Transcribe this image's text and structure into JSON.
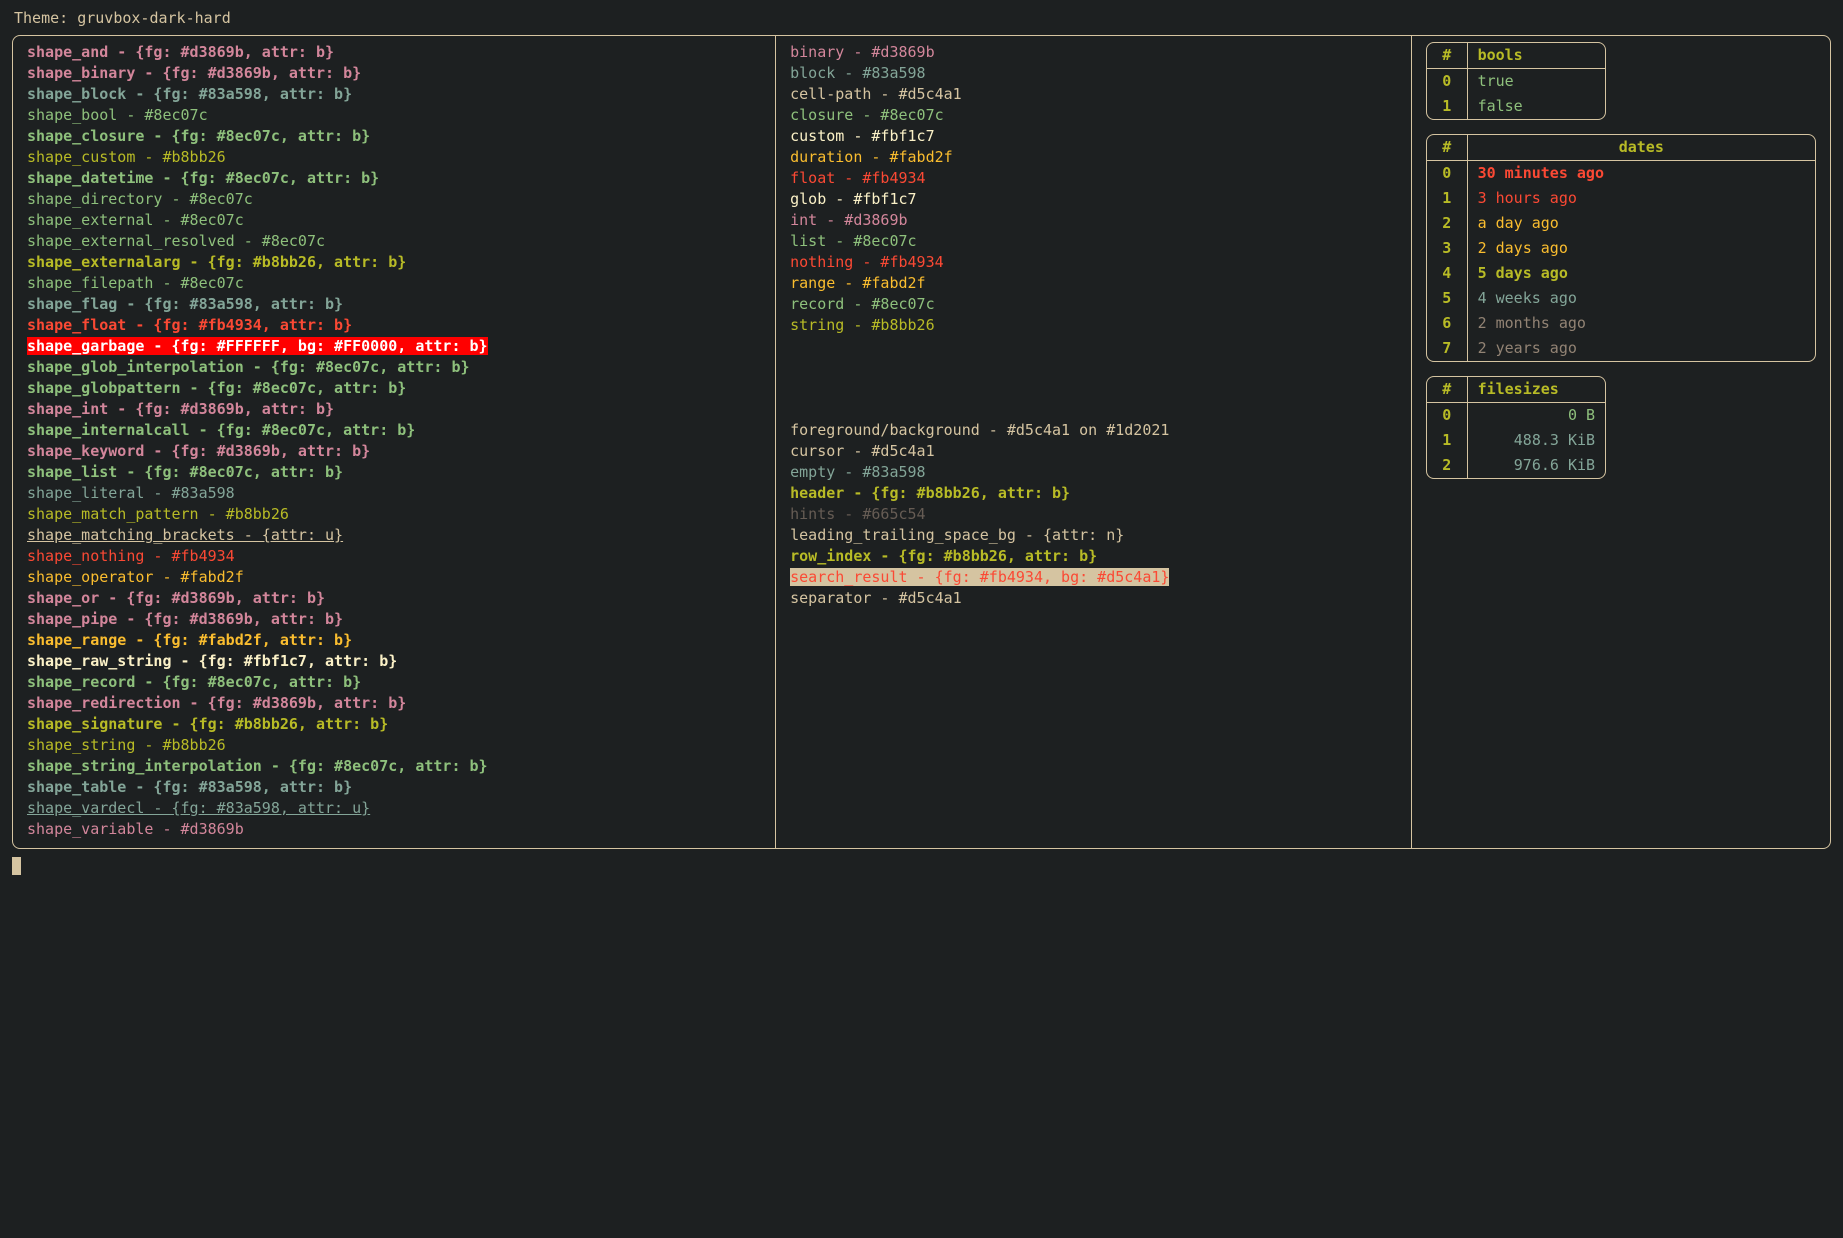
{
  "title": "Theme: gruvbox-dark-hard",
  "palette": {
    "fg": "#d5c4a1",
    "bg": "#1d2021",
    "yellowB": "#fabd2f",
    "yellow": "#b8bb26",
    "aqua": "#8ec07c",
    "blue": "#83a598",
    "purple": "#d3869b",
    "red": "#fb4934",
    "white": "#fbf1c7",
    "dim": "#665c54"
  },
  "shapes": [
    {
      "name": "shape_and",
      "def": "{fg: #d3869b, attr: b}",
      "fg": "#d3869b",
      "bold": true
    },
    {
      "name": "shape_binary",
      "def": "{fg: #d3869b, attr: b}",
      "fg": "#d3869b",
      "bold": true
    },
    {
      "name": "shape_block",
      "def": "{fg: #83a598, attr: b}",
      "fg": "#83a598",
      "bold": true
    },
    {
      "name": "shape_bool",
      "def": "#8ec07c",
      "fg": "#8ec07c"
    },
    {
      "name": "shape_closure",
      "def": "{fg: #8ec07c, attr: b}",
      "fg": "#8ec07c",
      "bold": true
    },
    {
      "name": "shape_custom",
      "def": "#b8bb26",
      "fg": "#b8bb26"
    },
    {
      "name": "shape_datetime",
      "def": "{fg: #8ec07c, attr: b}",
      "fg": "#8ec07c",
      "bold": true
    },
    {
      "name": "shape_directory",
      "def": "#8ec07c",
      "fg": "#8ec07c"
    },
    {
      "name": "shape_external",
      "def": "#8ec07c",
      "fg": "#8ec07c"
    },
    {
      "name": "shape_external_resolved",
      "def": "#8ec07c",
      "fg": "#8ec07c"
    },
    {
      "name": "shape_externalarg",
      "def": "{fg: #b8bb26, attr: b}",
      "fg": "#b8bb26",
      "bold": true
    },
    {
      "name": "shape_filepath",
      "def": "#8ec07c",
      "fg": "#8ec07c"
    },
    {
      "name": "shape_flag",
      "def": "{fg: #83a598, attr: b}",
      "fg": "#83a598",
      "bold": true
    },
    {
      "name": "shape_float",
      "def": "{fg: #fb4934, attr: b}",
      "fg": "#fb4934",
      "bold": true
    },
    {
      "name": "shape_garbage",
      "def": "{fg: #FFFFFF, bg: #FF0000, attr: b}",
      "fg": "#FFFFFF",
      "bg": "#FF0000",
      "bold": true
    },
    {
      "name": "shape_glob_interpolation",
      "def": "{fg: #8ec07c, attr: b}",
      "fg": "#8ec07c",
      "bold": true
    },
    {
      "name": "shape_globpattern",
      "def": "{fg: #8ec07c, attr: b}",
      "fg": "#8ec07c",
      "bold": true
    },
    {
      "name": "shape_int",
      "def": "{fg: #d3869b, attr: b}",
      "fg": "#d3869b",
      "bold": true
    },
    {
      "name": "shape_internalcall",
      "def": "{fg: #8ec07c, attr: b}",
      "fg": "#8ec07c",
      "bold": true
    },
    {
      "name": "shape_keyword",
      "def": "{fg: #d3869b, attr: b}",
      "fg": "#d3869b",
      "bold": true
    },
    {
      "name": "shape_list",
      "def": "{fg: #8ec07c, attr: b}",
      "fg": "#8ec07c",
      "bold": true
    },
    {
      "name": "shape_literal",
      "def": "#83a598",
      "fg": "#83a598"
    },
    {
      "name": "shape_match_pattern",
      "def": "#b8bb26",
      "fg": "#b8bb26"
    },
    {
      "name": "shape_matching_brackets",
      "def": "{attr: u}",
      "fg": "#d5c4a1",
      "under": true
    },
    {
      "name": "shape_nothing",
      "def": "#fb4934",
      "fg": "#fb4934"
    },
    {
      "name": "shape_operator",
      "def": "#fabd2f",
      "fg": "#fabd2f"
    },
    {
      "name": "shape_or",
      "def": "{fg: #d3869b, attr: b}",
      "fg": "#d3869b",
      "bold": true
    },
    {
      "name": "shape_pipe",
      "def": "{fg: #d3869b, attr: b}",
      "fg": "#d3869b",
      "bold": true
    },
    {
      "name": "shape_range",
      "def": "{fg: #fabd2f, attr: b}",
      "fg": "#fabd2f",
      "bold": true
    },
    {
      "name": "shape_raw_string",
      "def": "{fg: #fbf1c7, attr: b}",
      "fg": "#fbf1c7",
      "bold": true
    },
    {
      "name": "shape_record",
      "def": "{fg: #8ec07c, attr: b}",
      "fg": "#8ec07c",
      "bold": true
    },
    {
      "name": "shape_redirection",
      "def": "{fg: #d3869b, attr: b}",
      "fg": "#d3869b",
      "bold": true
    },
    {
      "name": "shape_signature",
      "def": "{fg: #b8bb26, attr: b}",
      "fg": "#b8bb26",
      "bold": true
    },
    {
      "name": "shape_string",
      "def": "#b8bb26",
      "fg": "#b8bb26"
    },
    {
      "name": "shape_string_interpolation",
      "def": "{fg: #8ec07c, attr: b}",
      "fg": "#8ec07c",
      "bold": true
    },
    {
      "name": "shape_table",
      "def": "{fg: #83a598, attr: b}",
      "fg": "#83a598",
      "bold": true
    },
    {
      "name": "shape_vardecl",
      "def": "{fg: #83a598, attr: u}",
      "fg": "#83a598",
      "under": true
    },
    {
      "name": "shape_variable",
      "def": "#d3869b",
      "fg": "#d3869b"
    }
  ],
  "types": [
    {
      "name": "binary",
      "def": "#d3869b",
      "fg": "#d3869b"
    },
    {
      "name": "block",
      "def": "#83a598",
      "fg": "#83a598"
    },
    {
      "name": "cell-path",
      "def": "#d5c4a1",
      "fg": "#d5c4a1"
    },
    {
      "name": "closure",
      "def": "#8ec07c",
      "fg": "#8ec07c"
    },
    {
      "name": "custom",
      "def": "#fbf1c7",
      "fg": "#fbf1c7"
    },
    {
      "name": "duration",
      "def": "#fabd2f",
      "fg": "#fabd2f"
    },
    {
      "name": "float",
      "def": "#fb4934",
      "fg": "#fb4934"
    },
    {
      "name": "glob",
      "def": "#fbf1c7",
      "fg": "#fbf1c7"
    },
    {
      "name": "int",
      "def": "#d3869b",
      "fg": "#d3869b"
    },
    {
      "name": "list",
      "def": "#8ec07c",
      "fg": "#8ec07c"
    },
    {
      "name": "nothing",
      "def": "#fb4934",
      "fg": "#fb4934"
    },
    {
      "name": "range",
      "def": "#fabd2f",
      "fg": "#fabd2f"
    },
    {
      "name": "record",
      "def": "#8ec07c",
      "fg": "#8ec07c"
    },
    {
      "name": "string",
      "def": "#b8bb26",
      "fg": "#b8bb26"
    }
  ],
  "misc": [
    {
      "name": "foreground/background",
      "def": "#d5c4a1 on #1d2021",
      "fg": "#d5c4a1"
    },
    {
      "name": "cursor",
      "def": "#d5c4a1",
      "fg": "#d5c4a1"
    },
    {
      "name": "empty",
      "def": "#83a598",
      "fg": "#83a598"
    },
    {
      "name": "header",
      "def": "{fg: #b8bb26, attr: b}",
      "fg": "#b8bb26",
      "bold": true
    },
    {
      "name": "hints",
      "def": "#665c54",
      "fg": "#665c54"
    },
    {
      "name": "leading_trailing_space_bg",
      "def": "{attr: n}",
      "fg": "#d5c4a1"
    },
    {
      "name": "row_index",
      "def": "{fg: #b8bb26, attr: b}",
      "fg": "#b8bb26",
      "bold": true
    },
    {
      "name": "search_result",
      "def": "{fg: #fb4934, bg: #d5c4a1}",
      "fg": "#fb4934",
      "bg": "#d5c4a1"
    },
    {
      "name": "separator",
      "def": "#d5c4a1",
      "fg": "#d5c4a1"
    }
  ],
  "tables": {
    "bools": {
      "header": "bools",
      "rows": [
        {
          "idx": "0",
          "val": "true",
          "fg": "#8ec07c"
        },
        {
          "idx": "1",
          "val": "false",
          "fg": "#8ec07c"
        }
      ]
    },
    "dates": {
      "header": "dates",
      "rows": [
        {
          "idx": "0",
          "val": "30 minutes ago",
          "fg": "#fb4934",
          "bold": true
        },
        {
          "idx": "1",
          "val": "3 hours ago",
          "fg": "#fb4934"
        },
        {
          "idx": "2",
          "val": "a day ago",
          "fg": "#fabd2f"
        },
        {
          "idx": "3",
          "val": "2 days ago",
          "fg": "#fabd2f"
        },
        {
          "idx": "4",
          "val": "5 days ago",
          "fg": "#b8bb26",
          "bold": true
        },
        {
          "idx": "5",
          "val": "4 weeks ago",
          "fg": "#83a598"
        },
        {
          "idx": "6",
          "val": "2 months ago",
          "fg": "#928374"
        },
        {
          "idx": "7",
          "val": "2 years ago",
          "fg": "#928374"
        }
      ]
    },
    "filesizes": {
      "header": "filesizes",
      "rows": [
        {
          "idx": "0",
          "val": "0 B",
          "fg": "#8ec07c"
        },
        {
          "idx": "1",
          "val": "488.3 KiB",
          "fg": "#83a598"
        },
        {
          "idx": "2",
          "val": "976.6 KiB",
          "fg": "#83a598"
        }
      ]
    }
  }
}
